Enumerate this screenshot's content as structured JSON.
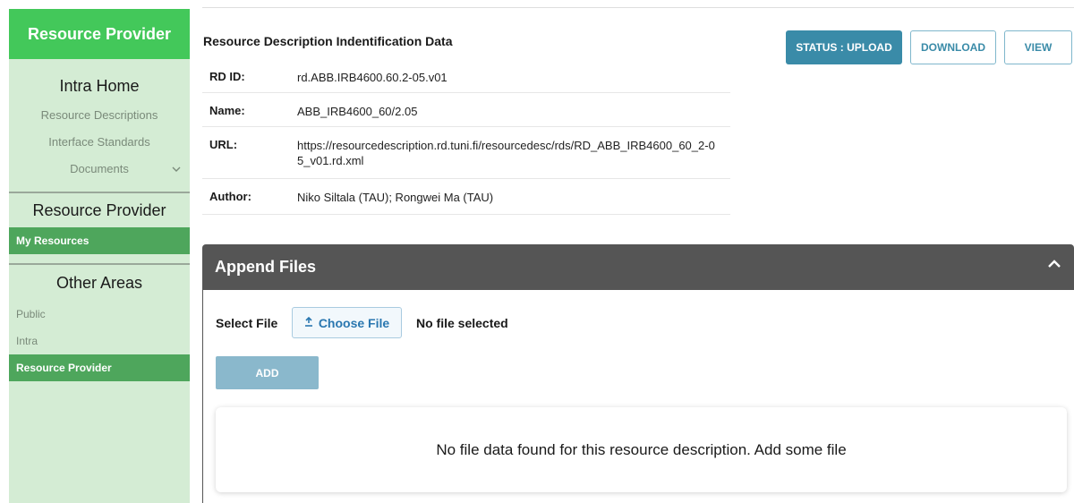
{
  "sidebar": {
    "header": "Resource Provider",
    "intra_home": "Intra Home",
    "intra_links": [
      "Resource Descriptions",
      "Interface Standards",
      "Documents"
    ],
    "resource_provider_title": "Resource Provider",
    "my_resources": "My Resources",
    "other_areas_title": "Other Areas",
    "other_links": [
      "Public",
      "Intra",
      "Resource Provider"
    ]
  },
  "main": {
    "title": "Resource Description Indentification Data",
    "fields": [
      {
        "label": "RD ID:",
        "value": "rd.ABB.IRB4600.60.2-05.v01"
      },
      {
        "label": "Name:",
        "value": "ABB_IRB4600_60/2.05"
      },
      {
        "label": "URL:",
        "value": "https://resourcedescription.rd.tuni.fi/resourcedesc/rds/RD_ABB_IRB4600_60_2-05_v01.rd.xml"
      },
      {
        "label": "Author:",
        "value": "Niko Siltala (TAU); Rongwei Ma (TAU)"
      }
    ],
    "buttons": {
      "status": "STATUS : UPLOAD",
      "download": "DOWNLOAD",
      "view": "VIEW"
    }
  },
  "append": {
    "title": "Append Files",
    "select_label": "Select File",
    "choose_button": "Choose File",
    "no_file": "No file selected",
    "add_button": "ADD",
    "empty_message": "No file data found for this resource description. Add some file"
  },
  "icons": {
    "documents_chevron": "chevron-down-icon",
    "collapse": "chevron-up-icon",
    "upload": "upload-icon"
  },
  "colors": {
    "sidebar_header": "#43c85a",
    "sidebar_bg": "#d4ecd4",
    "active_item": "#4ea65c",
    "primary": "#3a8ba8",
    "append_bar": "#555555"
  }
}
